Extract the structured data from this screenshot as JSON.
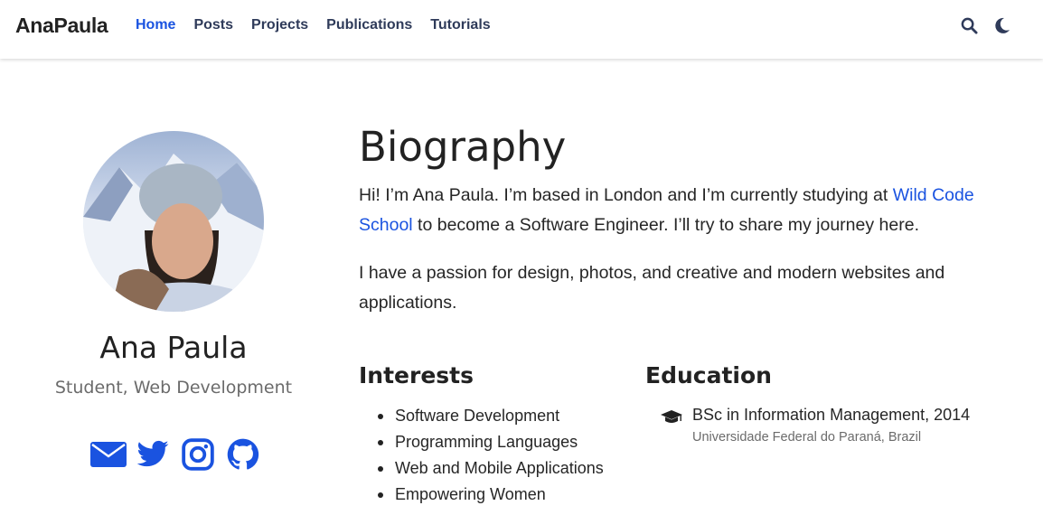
{
  "navbar": {
    "brand": "AnaPaula",
    "links": [
      {
        "label": "Home",
        "active": true
      },
      {
        "label": "Posts"
      },
      {
        "label": "Projects"
      },
      {
        "label": "Publications"
      },
      {
        "label": "Tutorials"
      }
    ],
    "icons": [
      "search-icon",
      "moon-icon"
    ]
  },
  "profile": {
    "name": "Ana Paula",
    "role": "Student, Web Development",
    "social": [
      "envelope-icon",
      "twitter-icon",
      "instagram-icon",
      "github-icon"
    ]
  },
  "biography": {
    "title": "Biography",
    "p1_before": "Hi! I’m Ana Paula. I’m based in London and I’m currently studying at ",
    "p1_link": "Wild Code School",
    "p1_after": " to become a Software Engineer. I’ll try to share my journey here.",
    "p2": "I have a passion for design, photos, and creative and modern websites and applications."
  },
  "interests": {
    "title": "Interests",
    "items": [
      "Software Development",
      "Programming Languages",
      "Web and Mobile Applications",
      "Empowering Women"
    ]
  },
  "education": {
    "title": "Education",
    "course": "BSc in Information Management, 2014",
    "institution": "Universidade Federal do Paraná, Brazil"
  },
  "colors": {
    "accent": "#1a53e0",
    "nav_text": "#2f3b5a",
    "muted": "#6b6b6b"
  }
}
